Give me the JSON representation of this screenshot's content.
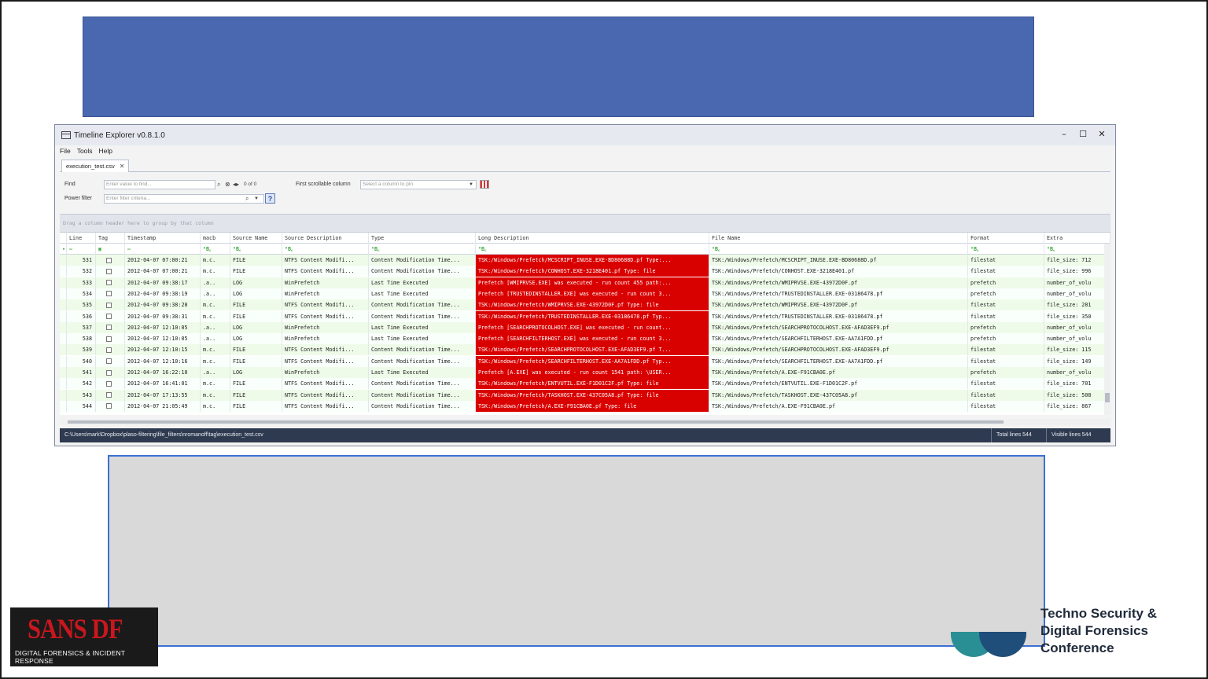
{
  "window": {
    "title": "Timeline Explorer v0.8.1.0",
    "controls": [
      "–",
      "☐",
      "✕"
    ],
    "menu": [
      "File",
      "Tools",
      "Help"
    ],
    "tab_label": "execution_test.csv",
    "tab_close": "✕"
  },
  "filters": {
    "find_label": "Find",
    "find_placeholder": "Enter value to find...",
    "find_count": "0 of 0",
    "power_filter_label": "Power filter",
    "power_filter_placeholder": "Enter filter criteria...",
    "first_scrollable_label": "First scrollable column",
    "pin_placeholder": "Select a column to pin",
    "help": "?"
  },
  "group_hint": "Drag a column header here to group by that column",
  "columns": [
    "Line",
    "Tag",
    "Timestamp",
    "macb",
    "Source Name",
    "Source Description",
    "Type",
    "Long Description",
    "File Name",
    "Format",
    "Extra"
  ],
  "filter_row": [
    "▾",
    "—",
    "▣",
    "—",
    "ᴬB꜀",
    "ᴬB꜀",
    "ᴬB꜀",
    "ᴬB꜀",
    "ᴬB꜀",
    "ᴬB꜀",
    "ᴬB꜀",
    "ᴬB꜀"
  ],
  "rows": [
    {
      "line": "531",
      "ts": "2012-04-07 07:00:21",
      "macb": "m.c.",
      "src": "FILE",
      "srcdesc": "NTFS Content Modifi...",
      "type": "Content Modification Time...",
      "long": "TSK:/Windows/Prefetch/MCSCRIPT_INUSE.EXE-BD80688D.pf Type:...",
      "file": "TSK:/Windows/Prefetch/MCSCRIPT_INUSE.EXE-BD80688D.pf",
      "format": "filestat",
      "extra": "file_size: 712"
    },
    {
      "line": "532",
      "ts": "2012-04-07 07:00:21",
      "macb": "m.c.",
      "src": "FILE",
      "srcdesc": "NTFS Content Modifi...",
      "type": "Content Modification Time...",
      "long": "TSK:/Windows/Prefetch/CONHOST.EXE-3218E401.pf Type: file",
      "file": "TSK:/Windows/Prefetch/CONHOST.EXE-3218E401.pf",
      "format": "filestat",
      "extra": "file_size: 996"
    },
    {
      "line": "533",
      "ts": "2012-04-07 09:38:17",
      "macb": ".a..",
      "src": "LOG",
      "srcdesc": "WinPrefetch",
      "type": "Last Time Executed",
      "long": "Prefetch [WMIPRVSE.EXE] was executed - run count 455 path:...",
      "file": "TSK:/Windows/Prefetch/WMIPRVSE.EXE-43972D0F.pf",
      "format": "prefetch",
      "extra": "number_of_volu"
    },
    {
      "line": "534",
      "ts": "2012-04-07 09:38:19",
      "macb": ".a..",
      "src": "LOG",
      "srcdesc": "WinPrefetch",
      "type": "Last Time Executed",
      "long": "Prefetch [TRUSTEDINSTALLER.EXE] was executed - run count 3...",
      "file": "TSK:/Windows/Prefetch/TRUSTEDINSTALLER.EXE-03186478.pf",
      "format": "prefetch",
      "extra": "number_of_volu"
    },
    {
      "line": "535",
      "ts": "2012-04-07 09:38:28",
      "macb": "m.c.",
      "src": "FILE",
      "srcdesc": "NTFS Content Modifi...",
      "type": "Content Modification Time...",
      "long": "TSK:/Windows/Prefetch/WMIPRVSE.EXE-43972D0F.pf Type: file",
      "file": "TSK:/Windows/Prefetch/WMIPRVSE.EXE-43972D0F.pf",
      "format": "filestat",
      "extra": "file_size: 281"
    },
    {
      "line": "536",
      "ts": "2012-04-07 09:38:31",
      "macb": "m.c.",
      "src": "FILE",
      "srcdesc": "NTFS Content Modifi...",
      "type": "Content Modification Time...",
      "long": "TSK:/Windows/Prefetch/TRUSTEDINSTALLER.EXE-03186478.pf Typ...",
      "file": "TSK:/Windows/Prefetch/TRUSTEDINSTALLER.EXE-03186478.pf",
      "format": "filestat",
      "extra": "file_size: 350"
    },
    {
      "line": "537",
      "ts": "2012-04-07 12:10:05",
      "macb": ".a..",
      "src": "LOG",
      "srcdesc": "WinPrefetch",
      "type": "Last Time Executed",
      "long": "Prefetch [SEARCHPROTOCOLHOST.EXE] was executed - run count...",
      "file": "TSK:/Windows/Prefetch/SEARCHPROTOCOLHOST.EXE-AFAD3EF9.pf",
      "format": "prefetch",
      "extra": "number_of_volu"
    },
    {
      "line": "538",
      "ts": "2012-04-07 12:10:05",
      "macb": ".a..",
      "src": "LOG",
      "srcdesc": "WinPrefetch",
      "type": "Last Time Executed",
      "long": "Prefetch [SEARCHFILTERHOST.EXE] was executed - run count 3...",
      "file": "TSK:/Windows/Prefetch/SEARCHFILTERHOST.EXE-AA7A1FDD.pf",
      "format": "prefetch",
      "extra": "number_of_volu"
    },
    {
      "line": "539",
      "ts": "2012-04-07 12:10:15",
      "macb": "m.c.",
      "src": "FILE",
      "srcdesc": "NTFS Content Modifi...",
      "type": "Content Modification Time...",
      "long": "TSK:/Windows/Prefetch/SEARCHPROTOCOLHOST.EXE-AFAD3EF9.pf T...",
      "file": "TSK:/Windows/Prefetch/SEARCHPROTOCOLHOST.EXE-AFAD3EF9.pf",
      "format": "filestat",
      "extra": "file_size: 115"
    },
    {
      "line": "540",
      "ts": "2012-04-07 12:10:16",
      "macb": "m.c.",
      "src": "FILE",
      "srcdesc": "NTFS Content Modifi...",
      "type": "Content Modification Time...",
      "long": "TSK:/Windows/Prefetch/SEARCHFILTERHOST.EXE-AA7A1FDD.pf Typ...",
      "file": "TSK:/Windows/Prefetch/SEARCHFILTERHOST.EXE-AA7A1FDD.pf",
      "format": "filestat",
      "extra": "file_size: 149"
    },
    {
      "line": "541",
      "ts": "2012-04-07 16:22:10",
      "macb": ".a..",
      "src": "LOG",
      "srcdesc": "WinPrefetch",
      "type": "Last Time Executed",
      "long": "Prefetch [A.EXE] was executed - run count 1541 path: \\USER...",
      "file": "TSK:/Windows/Prefetch/A.EXE-F91CBA0E.pf",
      "format": "prefetch",
      "extra": "number_of_volu"
    },
    {
      "line": "542",
      "ts": "2012-04-07 16:41:01",
      "macb": "m.c.",
      "src": "FILE",
      "srcdesc": "NTFS Content Modifi...",
      "type": "Content Modification Time...",
      "long": "TSK:/Windows/Prefetch/ENTVUTIL.EXE-F1D01C2F.pf Type: file",
      "file": "TSK:/Windows/Prefetch/ENTVUTIL.EXE-F1D01C2F.pf",
      "format": "filestat",
      "extra": "file_size: 701"
    },
    {
      "line": "543",
      "ts": "2012-04-07 17:13:55",
      "macb": "m.c.",
      "src": "FILE",
      "srcdesc": "NTFS Content Modifi...",
      "type": "Content Modification Time...",
      "long": "TSK:/Windows/Prefetch/TASKHOST.EXE-437C05A8.pf Type: file",
      "file": "TSK:/Windows/Prefetch/TASKHOST.EXE-437C05A8.pf",
      "format": "filestat",
      "extra": "file_size: 508"
    },
    {
      "line": "544",
      "ts": "2012-04-07 21:05:49",
      "macb": "m.c.",
      "src": "FILE",
      "srcdesc": "NTFS Content Modifi...",
      "type": "Content Modification Time...",
      "long": "TSK:/Windows/Prefetch/A.EXE-F91CBA0E.pf Type: file",
      "file": "TSK:/Windows/Prefetch/A.EXE-F91CBA0E.pf",
      "format": "filestat",
      "extra": "file_size: 867"
    }
  ],
  "status": {
    "path": "C:\\Users\\mark\\Dropbox\\plaso-filtering\\file_filters\\nromanoff\\tag\\execution_test.csv",
    "total": "Total lines 544",
    "visible": "Visible lines 544"
  },
  "logos": {
    "sans_main": "SANS DF",
    "sans_sub": "DIGITAL FORENSICS & INCIDENT RESPONSE",
    "techno_lines": [
      "Techno Security &",
      "Digital Forensics",
      "Conference"
    ]
  },
  "colors": {
    "title_band": "#4a68b0",
    "highlight_red": "#d90000",
    "row_green": "#eefbe9",
    "status_bar": "#2e3a4f"
  }
}
